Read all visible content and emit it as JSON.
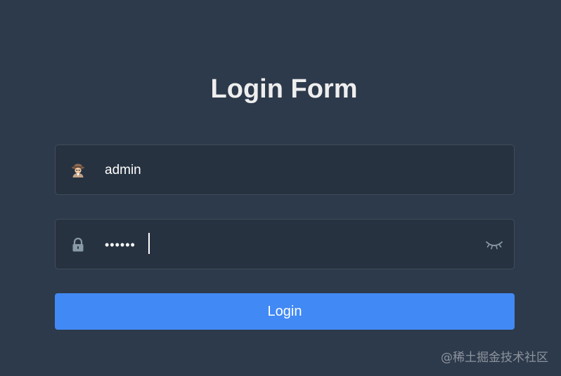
{
  "form": {
    "title": "Login Form",
    "username": {
      "value": "admin",
      "icon": "user-avatar-icon"
    },
    "password": {
      "masked_value": "••••••",
      "icon": "lock-icon",
      "toggle_icon": "eye-closed-icon"
    },
    "login_button_label": "Login"
  },
  "watermark": "@稀土掘金技术社区",
  "colors": {
    "background": "#2d3a4b",
    "primary": "#4189f4",
    "title": "#eeeeee"
  }
}
